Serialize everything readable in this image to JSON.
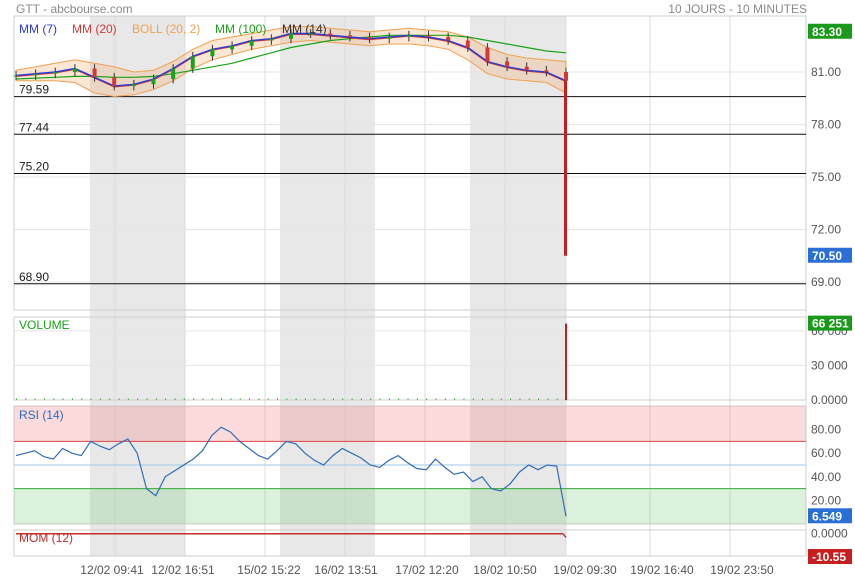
{
  "header": {
    "title": "GTT - abcbourse.com",
    "timeframe": "10 JOURS - 10 MINUTES"
  },
  "legend": {
    "mm7": "MM (7)",
    "mm20": "MM (20)",
    "boll": "BOLL (20, 2)",
    "mm100": "MM (100)",
    "mm14": "MM (14)"
  },
  "colors": {
    "mm7": "#2b3bd6",
    "mm20": "#d23a3a",
    "boll": "#f0a050",
    "mm100": "#1aa31a",
    "rsi": "#2f6db5",
    "mom": "#c0302a",
    "volume_label": "#1aa31a",
    "grey_band": "#e8e8e8"
  },
  "chart_data": [
    {
      "type": "line",
      "panel": "price",
      "ylim": [
        67.4,
        84.2
      ],
      "y_ticks": [
        "81.00",
        "78.00",
        "75.00",
        "72.00",
        "69.00"
      ],
      "y_tick_values": [
        81,
        78,
        75,
        72,
        69
      ],
      "levels": [
        {
          "label": "79.59",
          "value": 79.59
        },
        {
          "label": "77.44",
          "value": 77.44
        },
        {
          "label": "75.20",
          "value": 75.2
        },
        {
          "label": "68.90",
          "value": 68.9
        }
      ],
      "badges": [
        {
          "label": "83.30",
          "value": 83.3,
          "color": "#1a9a1a"
        },
        {
          "label": "70.50",
          "value": 70.5,
          "color": "#2a6fd6"
        }
      ],
      "x_tick_labels": [
        "12/02 09:41",
        "12/02 16:51",
        "15/02 15:22",
        "16/02 13:51",
        "17/02 12:20",
        "18/02 10:50",
        "19/02 09:30",
        "19/02 16:40",
        "19/02 23:50"
      ],
      "series": [
        {
          "name": "MM (7)",
          "key": "close",
          "values": [
            80.8,
            80.9,
            81.0,
            81.2,
            80.7,
            80.2,
            80.3,
            80.6,
            81.2,
            81.9,
            82.3,
            82.5,
            82.8,
            82.9,
            83.2,
            83.2,
            83.1,
            83.0,
            82.9,
            83.0,
            83.1,
            83.0,
            82.8,
            82.4,
            81.6,
            81.3,
            81.1,
            81.0,
            80.5
          ]
        },
        {
          "name": "MM (100)",
          "key": "mm100",
          "values": [
            80.6,
            80.65,
            80.7,
            80.75,
            80.75,
            80.7,
            80.7,
            80.75,
            80.9,
            81.1,
            81.3,
            81.5,
            81.8,
            82.1,
            82.4,
            82.6,
            82.8,
            82.9,
            83.0,
            83.1,
            83.1,
            83.1,
            83.1,
            83.0,
            82.8,
            82.6,
            82.4,
            82.2,
            82.1
          ]
        },
        {
          "name": "BOLL (20, 2)",
          "key": "boll_up",
          "values": [
            81.1,
            81.3,
            81.5,
            81.7,
            81.5,
            81.3,
            81.0,
            81.1,
            81.6,
            82.3,
            82.8,
            83.0,
            83.2,
            83.4,
            83.6,
            83.6,
            83.5,
            83.4,
            83.3,
            83.4,
            83.5,
            83.4,
            83.3,
            83.0,
            82.4,
            82.0,
            81.8,
            81.7,
            81.6
          ]
        },
        {
          "name": "BOLL (20, 2)",
          "key": "boll_dn",
          "values": [
            80.5,
            80.5,
            80.5,
            80.4,
            79.8,
            79.6,
            79.7,
            80.0,
            80.5,
            81.2,
            81.7,
            82.0,
            82.3,
            82.5,
            82.7,
            82.8,
            82.7,
            82.6,
            82.5,
            82.6,
            82.6,
            82.5,
            82.3,
            81.7,
            80.9,
            80.6,
            80.5,
            80.4,
            79.8
          ]
        }
      ],
      "final_drop": {
        "from": 80.5,
        "to": 70.5
      }
    },
    {
      "type": "bar",
      "panel": "volume",
      "title": "VOLUME",
      "y_ticks": [
        "60 000",
        "30 000",
        "0.0000"
      ],
      "y_tick_values": [
        60000,
        30000,
        0
      ],
      "ylim": [
        0,
        72000
      ],
      "badge": {
        "label": "66 251",
        "value": 66251,
        "color": "#1a9a1a"
      },
      "last_value": 66251
    },
    {
      "type": "line",
      "panel": "rsi",
      "title": "RSI (14)",
      "ylim": [
        0,
        100
      ],
      "y_ticks": [
        "80.00",
        "60.00",
        "40.00",
        "20.00"
      ],
      "y_tick_values": [
        80,
        60,
        40,
        20
      ],
      "overbought": 70,
      "oversold": 30,
      "midline": 50,
      "badge": {
        "label": "6.549",
        "value": 6.549,
        "color": "#2a6fd6"
      },
      "values": [
        58,
        60,
        62,
        57,
        55,
        64,
        60,
        58,
        70,
        66,
        63,
        68,
        72,
        60,
        30,
        24,
        40,
        45,
        50,
        55,
        62,
        75,
        82,
        78,
        70,
        64,
        58,
        55,
        62,
        70,
        68,
        60,
        54,
        50,
        58,
        64,
        60,
        56,
        50,
        48,
        54,
        58,
        52,
        47,
        46,
        55,
        48,
        42,
        44,
        36,
        40,
        30,
        28,
        34,
        44,
        50,
        46,
        50,
        49,
        6.5
      ]
    },
    {
      "type": "line",
      "panel": "momentum",
      "title": "MOM (12)",
      "y_ticks": [
        "0.0000"
      ],
      "y_tick_values": [
        0
      ],
      "ylim": [
        -12,
        2
      ],
      "badge": {
        "label": "-10.55",
        "value": -10.55,
        "color": "#c81e1e"
      }
    }
  ]
}
